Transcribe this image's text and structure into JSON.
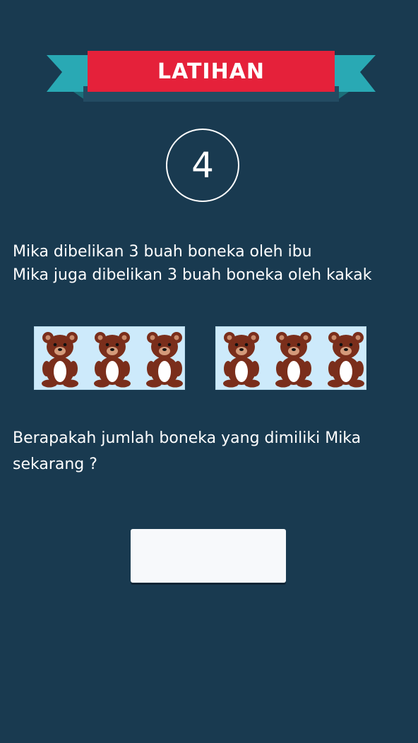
{
  "banner": {
    "title": "LATIHAN",
    "ribbon_color": "#e5213a",
    "tail_color": "#29a9b4"
  },
  "question_number": "4",
  "story": {
    "line1": "Mika dibelikan 3 buah boneka oleh ibu",
    "line2": "Mika juga dibelikan 3 buah boneka oleh kakak"
  },
  "bear_groups": [
    {
      "count": 3,
      "icon": "teddy-bear-icon"
    },
    {
      "count": 3,
      "icon": "teddy-bear-icon"
    }
  ],
  "question": {
    "line1": "Berapakah jumlah boneka yang dimiliki Mika",
    "line2": "sekarang ?"
  },
  "answer_field": {
    "value": ""
  },
  "colors": {
    "background": "#193a50",
    "bear_box": "#cdeafb",
    "bear_body": "#7a2e1b",
    "bear_belly": "#ffffff"
  }
}
